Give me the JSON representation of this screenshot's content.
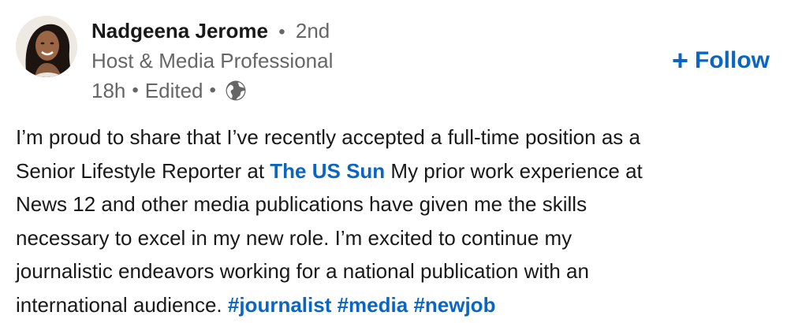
{
  "post": {
    "author": {
      "name": "Nadgeena Jerome",
      "degree": "2nd",
      "headline": "Host & Media Professional",
      "time": "18h",
      "edited": "Edited",
      "visibility_icon": "globe-icon"
    },
    "follow": {
      "plus": "+",
      "label": "Follow"
    },
    "separator": "•",
    "body": {
      "line1": "I’m proud to share that I’ve recently accepted a full-time position as a",
      "line2_pre": "Senior Lifestyle Reporter at ",
      "company_link": "The US Sun",
      "line2_post": " My prior work experience at",
      "line3": "News 12 and other media publications have given me the skills",
      "line4": "necessary to excel in my new role. I’m excited to continue my",
      "line5": "journalistic endeavors working for a national publication with an",
      "line6_pre": "international audience. ",
      "hashtags": [
        "#journalist",
        "#media",
        "#newjob"
      ]
    }
  },
  "colors": {
    "link": "#0a66c2",
    "text": "#191919",
    "muted": "#666666"
  }
}
